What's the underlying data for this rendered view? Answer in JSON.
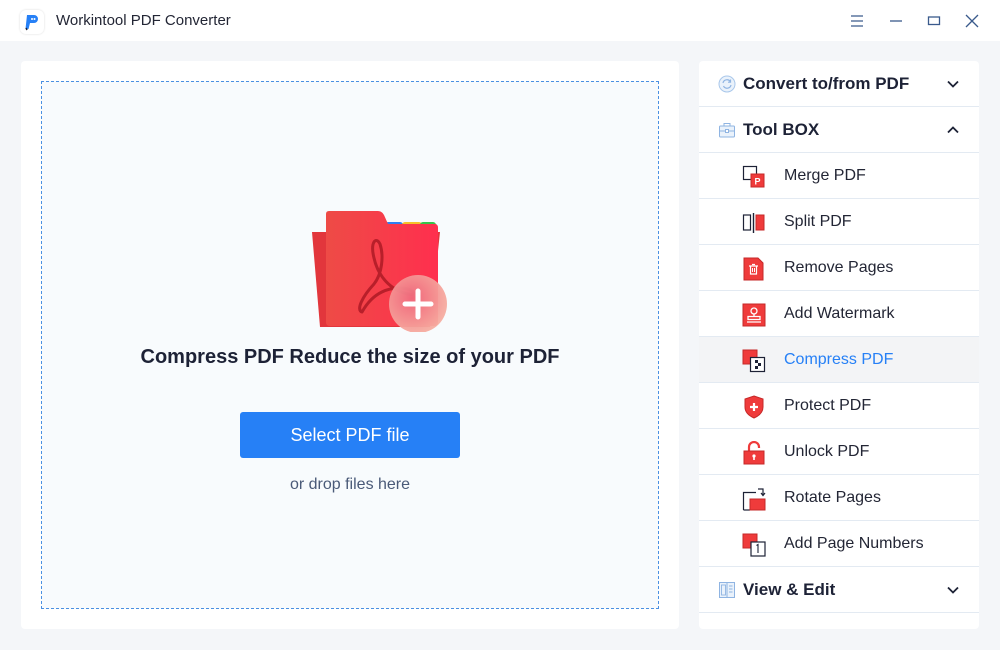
{
  "window": {
    "title": "Workintool PDF Converter",
    "controls": [
      "menu",
      "minimize",
      "maximize",
      "close"
    ]
  },
  "main": {
    "headline": "Compress PDF Reduce the size of your PDF",
    "select_button": "Select PDF file",
    "drop_hint": "or drop files here",
    "accent_color": "#2680f6"
  },
  "sidebar": {
    "sections": [
      {
        "label": "Convert to/from PDF",
        "icon": "convert-icon",
        "expanded": false
      },
      {
        "label": "Tool BOX",
        "icon": "toolbox-icon",
        "expanded": true
      },
      {
        "label": "View & Edit",
        "icon": "view-edit-icon",
        "expanded": false
      }
    ],
    "tools": [
      {
        "label": "Merge PDF",
        "icon": "merge-pdf-icon",
        "active": false
      },
      {
        "label": "Split PDF",
        "icon": "split-pdf-icon",
        "active": false
      },
      {
        "label": "Remove Pages",
        "icon": "remove-pages-icon",
        "active": false
      },
      {
        "label": "Add Watermark",
        "icon": "watermark-icon",
        "active": false
      },
      {
        "label": "Compress PDF",
        "icon": "compress-pdf-icon",
        "active": true
      },
      {
        "label": "Protect PDF",
        "icon": "shield-icon",
        "active": false
      },
      {
        "label": "Unlock PDF",
        "icon": "unlock-icon",
        "active": false
      },
      {
        "label": "Rotate Pages",
        "icon": "rotate-pages-icon",
        "active": false
      },
      {
        "label": "Add Page Numbers",
        "icon": "page-numbers-icon",
        "active": false
      }
    ]
  }
}
